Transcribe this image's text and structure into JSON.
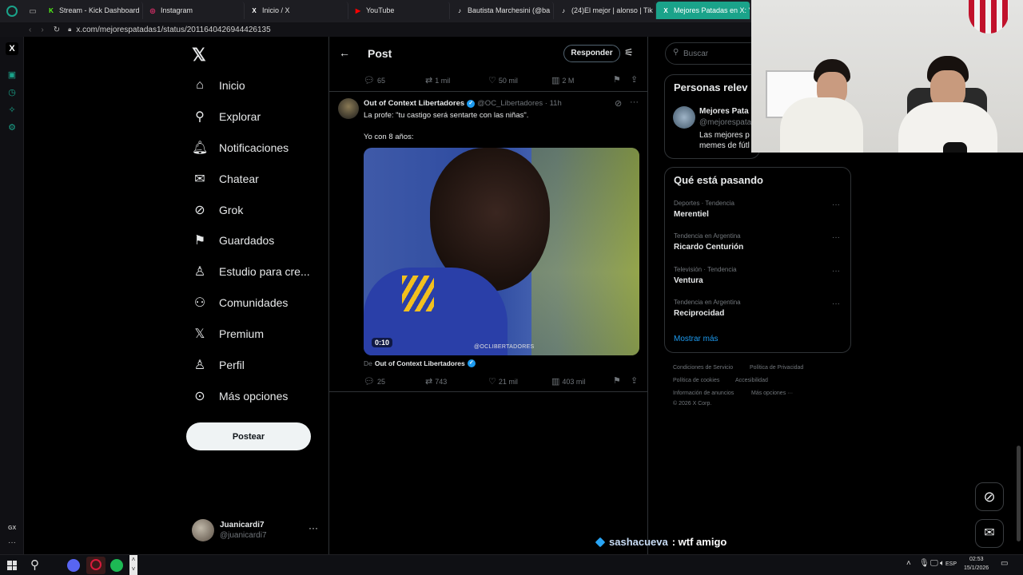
{
  "browser": {
    "tabs": [
      {
        "label": "Stream - Kick Dashboard",
        "fav": "K",
        "color": "#53fc18"
      },
      {
        "label": "Instagram",
        "fav": "◎",
        "color": "#e1306c"
      },
      {
        "label": "Inicio / X",
        "fav": "X",
        "color": "#ffffff"
      },
      {
        "label": "YouTube",
        "fav": "▶",
        "color": "#ff0000"
      },
      {
        "label": "Bautista Marchesini (@ba",
        "fav": "♪",
        "color": "#ffffff"
      },
      {
        "label": "(24)El mejor | alonso | Tik",
        "fav": "♪",
        "color": "#ffffff"
      },
      {
        "label": "Mejores Patadas en X: \"E",
        "fav": "X",
        "color": "#ffffff"
      }
    ],
    "url": "x.com/mejorespatadas1/status/2011640426944426135"
  },
  "nav": {
    "items": [
      {
        "label": "Inicio",
        "icon": "home-icon",
        "glyph": "⌂"
      },
      {
        "label": "Explorar",
        "icon": "search-icon",
        "glyph": "⚲"
      },
      {
        "label": "Notificaciones",
        "icon": "bell-icon",
        "glyph": "🔔︎"
      },
      {
        "label": "Chatear",
        "icon": "mail-icon",
        "glyph": "✉"
      },
      {
        "label": "Grok",
        "icon": "grok-icon",
        "glyph": "⊘"
      },
      {
        "label": "Guardados",
        "icon": "bookmark-icon",
        "glyph": "⚑"
      },
      {
        "label": "Estudio para cre...",
        "icon": "studio-icon",
        "glyph": "♙"
      },
      {
        "label": "Comunidades",
        "icon": "communities-icon",
        "glyph": "⚇"
      },
      {
        "label": "Premium",
        "icon": "x-premium-icon",
        "glyph": "𝕏"
      },
      {
        "label": "Perfil",
        "icon": "profile-icon",
        "glyph": "♙"
      },
      {
        "label": "Más opciones",
        "icon": "more-options-icon",
        "glyph": "⊙"
      }
    ],
    "post_label": "Postear",
    "account": {
      "name": "Juanicardi7",
      "handle": "@juanicardi7"
    }
  },
  "header": {
    "title": "Post",
    "reply_label": "Responder"
  },
  "parent_metrics": {
    "replies": "65",
    "reposts": "1 mil",
    "likes": "50 mil",
    "views": "2 M"
  },
  "tweet": {
    "author": "Out of Context Libertadores",
    "handle": "@OC_Libertadores · 11h",
    "line1": "La profe: \"tu castigo será sentarte con las niñas\".",
    "line2": "Yo con 8 años:",
    "duration": "0:10",
    "watermark": "@OCLIBERTADORES",
    "from_prefix": "De",
    "from_author": "Out of Context Libertadores",
    "metrics": {
      "replies": "25",
      "reposts": "743",
      "likes": "21 mil",
      "views": "403 mil"
    }
  },
  "right": {
    "search_placeholder": "Buscar",
    "people_title": "Personas relev",
    "person": {
      "name": "Mejores Pata",
      "handle": "@mejorespata",
      "bio1": "Las mejores p",
      "bio2": "memes de fútl"
    },
    "trends_title": "Qué está pasando",
    "trends": [
      {
        "category": "Deportes · Tendencia",
        "name": "Merentiel"
      },
      {
        "category": "Tendencia en Argentina",
        "name": "Ricardo Centurión"
      },
      {
        "category": "Televisión · Tendencia",
        "name": "Ventura"
      },
      {
        "category": "Tendencia en Argentina",
        "name": "Reciprocidad"
      }
    ],
    "show_more": "Mostrar más",
    "footer": [
      "Condiciones de Servicio",
      "Política de Privacidad",
      "Política de cookies",
      "Accesibilidad",
      "Información de anuncios",
      "Más opciones ···",
      "© 2026 X Corp."
    ]
  },
  "chat": {
    "user": "sashacueva",
    "message": ": wtf amigo"
  },
  "taskbar": {
    "lang": "ESP",
    "time": "02:53",
    "date": "15/1/2026"
  },
  "opera_bottom": "GX"
}
